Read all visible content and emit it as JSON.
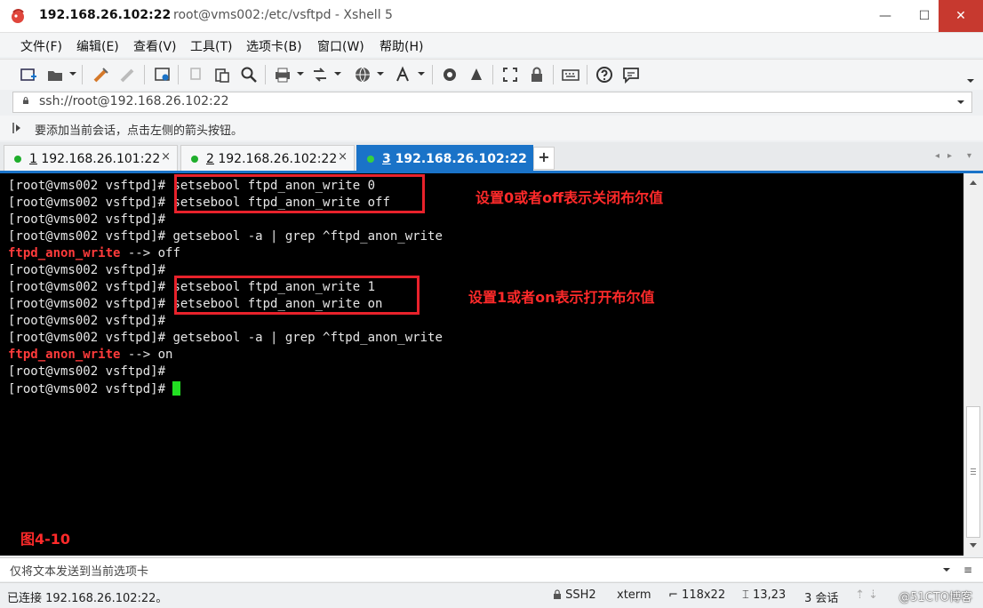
{
  "window": {
    "title_host": "192.168.26.102:22",
    "title_path": "root@vms002:/etc/vsftpd - Xshell 5",
    "minimize_glyph": "—",
    "maximize_glyph": "☐",
    "close_glyph": "✕"
  },
  "menu": [
    "文件(F)",
    "编辑(E)",
    "查看(V)",
    "工具(T)",
    "选项卡(B)",
    "窗口(W)",
    "帮助(H)"
  ],
  "toolbar_icons": [
    "new-session-icon",
    "open-folder-icon",
    "connect-icon",
    "disconnect-icon",
    "properties-icon",
    "copy-icon",
    "paste-icon",
    "find-icon",
    "print-icon",
    "transfer-icon",
    "globe-icon",
    "font-icon",
    "xftp-icon",
    "xmanager-icon",
    "fullscreen-icon",
    "lock-icon",
    "keyboard-icon",
    "help-icon",
    "chat-icon"
  ],
  "address": {
    "value": "ssh://root@192.168.26.102:22"
  },
  "hint": {
    "text": "要添加当前会话，点击左侧的箭头按钮。"
  },
  "tabs": [
    {
      "number": "1",
      "label": " 192.168.26.101:22",
      "active": false
    },
    {
      "number": "2",
      "label": " 192.168.26.102:22",
      "active": false
    },
    {
      "number": "3",
      "label": " 192.168.26.102:22",
      "active": true
    }
  ],
  "tab_add": "+",
  "tab_close": "×",
  "tab_nav_left": "◂",
  "tab_nav_right": "▸",
  "tab_nav_menu": "▾",
  "terminal": {
    "prompt": "[root@vms002 vsftpd]# ",
    "lines": [
      {
        "prompt": "[root@vms002 vsftpd]#",
        "cmd": " setsebool ftpd_anon_write 0"
      },
      {
        "prompt": "[root@vms002 vsftpd]#",
        "cmd": " setsebool ftpd_anon_write off"
      },
      {
        "prompt": "[root@vms002 vsftpd]#",
        "cmd": ""
      },
      {
        "prompt": "[root@vms002 vsftpd]#",
        "cmd": " getsebool -a | grep ^ftpd_anon_write"
      },
      {
        "highlight": "ftpd_anon_write",
        "rest": " --> off"
      },
      {
        "prompt": "[root@vms002 vsftpd]#",
        "cmd": ""
      },
      {
        "prompt": "[root@vms002 vsftpd]#",
        "cmd": " setsebool ftpd_anon_write 1"
      },
      {
        "prompt": "[root@vms002 vsftpd]#",
        "cmd": " setsebool ftpd_anon_write on"
      },
      {
        "prompt": "[root@vms002 vsftpd]#",
        "cmd": ""
      },
      {
        "prompt": "[root@vms002 vsftpd]#",
        "cmd": " getsebool -a | grep ^ftpd_anon_write"
      },
      {
        "highlight": "ftpd_anon_write",
        "rest": " --> on"
      },
      {
        "prompt": "[root@vms002 vsftpd]#",
        "cmd": ""
      },
      {
        "prompt": "[root@vms002 vsftpd]#",
        "cmd": " "
      }
    ],
    "annotation_off": "设置0或者off表示关闭布尔值",
    "annotation_on": "设置1或者on表示打开布尔值",
    "figure_label": "图4-10"
  },
  "send_bar": {
    "placeholder": "仅将文本发送到当前选项卡",
    "menu_glyph": "≡"
  },
  "status": {
    "connected": "已连接 192.168.26.102:22。",
    "protocol": "SSH2",
    "terminal_type": "xterm",
    "size": "118x22",
    "cursor_pos": "13,23",
    "sessions": "3 会话",
    "watermark": "@51CTO博客"
  },
  "colors": {
    "accent": "#1a73c8",
    "annotation_red": "#ff2a2a",
    "cursor_green": "#22e022",
    "close_red": "#c7392f"
  }
}
